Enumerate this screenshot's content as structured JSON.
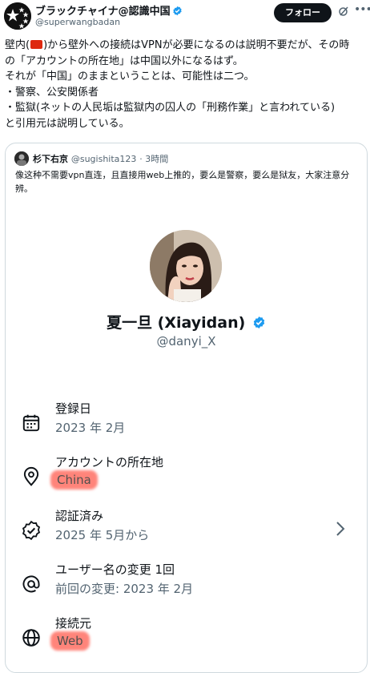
{
  "tweet": {
    "author_name": "ブラックチャイナ@認識中国",
    "author_handle": "@superwangbadan",
    "follow_label": "フォロー",
    "text_lines": [
      "壁内(",
      ")から壁外への接続はVPNが必要になるのは説明不要だが、その時",
      "の「アカウントの所在地」は中国以外になるはず。",
      "それが「中国」のままということは、可能性は二つ。",
      "・警察、公安関係者",
      "・監獄(ネットの人民垢は監獄内の囚人の「刑務作業」と言われている)",
      "と引用元は説明している。"
    ]
  },
  "quote": {
    "author_name": "杉下右京",
    "author_handle": "@sugishita123",
    "time": "· 3時間",
    "text": "像这种不需要vpn直连，且直接用web上推的，要么是警察，要么是狱友，大家注意分辨。",
    "profile": {
      "name": "夏一旦 (Xiayidan)",
      "handle": "@danyi_X",
      "rows": [
        {
          "label": "登録日",
          "value": "2023 年 2月",
          "icon": "calendar-icon"
        },
        {
          "label": "アカウントの所在地",
          "value": "China",
          "icon": "location-pin-icon"
        },
        {
          "label": "認証済み",
          "value": "2025 年 5月から",
          "icon": "verified-badge-icon"
        },
        {
          "label": "ユーザー名の変更 1回",
          "value": "前回の変更: 2023 年 2月",
          "icon": "at-sign-icon"
        },
        {
          "label": "接続元",
          "value": "Web",
          "icon": "globe-icon"
        }
      ]
    }
  },
  "colors": {
    "verified_blue": "#1d9bf0",
    "highlight_red": "#ff5546",
    "text_secondary": "#536471",
    "follow_button": "#0f1419"
  }
}
